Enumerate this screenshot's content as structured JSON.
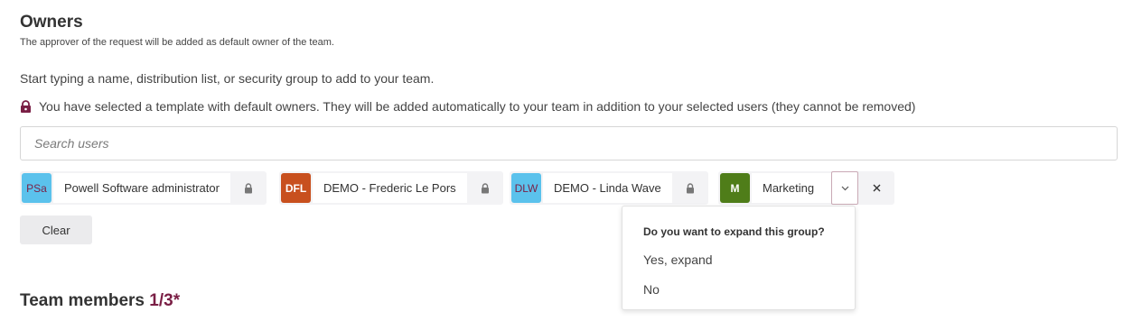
{
  "owners": {
    "title": "Owners",
    "subtitle": "The approver of the request will be added as default owner of the team.",
    "hint": "Start typing a name, distribution list, or security group to add to your team.",
    "template_note": "You have selected a template with default owners. They will be added automatically to your team in addition to your selected users (they cannot be removed)",
    "template_note_icon": "lock-icon"
  },
  "search": {
    "placeholder": "Search users",
    "value": ""
  },
  "selected_owners": [
    {
      "initials": "PSa",
      "name": "Powell Software administrator",
      "avatar_color": "#5bc2ec",
      "initials_color": "#7a1f45",
      "locked": true
    },
    {
      "initials": "DFL",
      "name": "DEMO - Frederic Le Pors",
      "avatar_color": "#c8501e",
      "initials_color": "#ffffff",
      "locked": true
    },
    {
      "initials": "DLW",
      "name": "DEMO - Linda Wave",
      "avatar_color": "#5bc2ec",
      "initials_color": "#7a1f45",
      "locked": true
    },
    {
      "initials": "M",
      "name": "Marketing",
      "avatar_color": "#4f7d19",
      "initials_color": "#ffffff",
      "locked": false
    }
  ],
  "clear_label": "Clear",
  "expand_popup": {
    "question": "Do you want to expand this group?",
    "yes": "Yes, expand",
    "no": "No"
  },
  "team_members": {
    "title": "Team members",
    "count": "1/3*"
  },
  "colors": {
    "accent": "#7a1f45",
    "lock_icon": "#7a1f45",
    "chip_bg": "#f3f3f5"
  }
}
